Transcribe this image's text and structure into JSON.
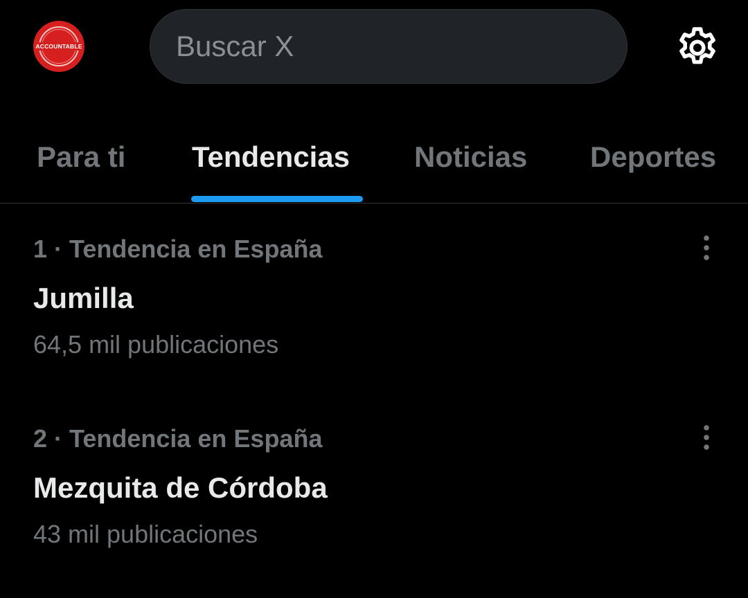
{
  "header": {
    "avatar_text": "ACCOUNTABLE",
    "search_placeholder": "Buscar X",
    "settings_icon": "gear-icon"
  },
  "tabs": [
    {
      "label": "Para ti",
      "active": false
    },
    {
      "label": "Tendencias",
      "active": true
    },
    {
      "label": "Noticias",
      "active": false
    },
    {
      "label": "Deportes",
      "active": false
    }
  ],
  "trends": [
    {
      "meta": "1 · Tendencia en España",
      "name": "Jumilla",
      "count": "64,5 mil publicaciones",
      "more_icon": "more-vertical-icon"
    },
    {
      "meta": "2 · Tendencia en España",
      "name": "Mezquita de Córdoba",
      "count": "43 mil publicaciones",
      "more_icon": "more-vertical-icon"
    }
  ],
  "colors": {
    "background": "#000000",
    "accent": "#1d9bf0",
    "text_primary": "#e7e9ea",
    "text_secondary": "#71767b",
    "search_bg": "#202327",
    "avatar_red": "#d6201f"
  }
}
